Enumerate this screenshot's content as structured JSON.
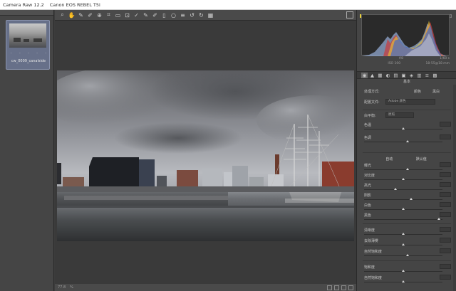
{
  "window": {
    "app_title": "Camera Raw 12.2",
    "camera": "Canon EOS REBEL T5i"
  },
  "filmstrip": {
    "header": "",
    "thumbnail": {
      "stars": [
        "·",
        "·",
        "·",
        "·",
        "·"
      ],
      "filename": "cw_0009_canalside"
    }
  },
  "toolbar": {
    "tools": [
      {
        "name": "zoom-icon",
        "glyph": "⌕"
      },
      {
        "name": "hand-icon",
        "glyph": "✋"
      },
      {
        "name": "white-balance-icon",
        "glyph": "✎"
      },
      {
        "name": "color-sampler-icon",
        "glyph": "✐"
      },
      {
        "name": "targeted-adjustment-icon",
        "glyph": "⊕"
      },
      {
        "name": "crop-icon",
        "glyph": "⌗"
      },
      {
        "name": "straighten-icon",
        "glyph": "▭"
      },
      {
        "name": "transform-icon",
        "glyph": "⊡"
      },
      {
        "name": "spot-removal-icon",
        "glyph": "✓"
      },
      {
        "name": "red-eye-icon",
        "glyph": "✎"
      },
      {
        "name": "adjustment-brush-icon",
        "glyph": "✐"
      },
      {
        "name": "graduated-filter-icon",
        "glyph": "▯"
      },
      {
        "name": "radial-filter-icon",
        "glyph": "○"
      },
      {
        "name": "preferences-icon",
        "glyph": "≡"
      },
      {
        "name": "rotate-left-icon",
        "glyph": "↺"
      },
      {
        "name": "rotate-right-icon",
        "glyph": "↻"
      },
      {
        "name": "trash-icon",
        "glyph": "▦"
      }
    ]
  },
  "status": {
    "left": [
      "77.8",
      "%"
    ],
    "center": "",
    "right_icons": [
      "before-after-icon",
      "swap-icon",
      "copy-icon",
      "settings-icon"
    ]
  },
  "panel": {
    "readout": {
      "row1": [
        "",
        "f/8",
        "1/60 s"
      ],
      "row2": [
        "",
        "ISO 100",
        "18-55@18 mm"
      ]
    },
    "tabs": [
      "basic-icon",
      "tone-curve-icon",
      "detail-icon",
      "hsl-icon",
      "split-toning-icon",
      "lens-icon",
      "effects-icon",
      "calibration-icon",
      "presets-icon",
      "snapshots-icon"
    ],
    "section_title": "基本",
    "treatment": {
      "label": "处理方式:",
      "color": "颜色",
      "bw": "黑白"
    },
    "profile": {
      "label": "配置文件:",
      "value": "Adobe 颜色"
    },
    "white_balance": {
      "label": "白平衡:",
      "value": "原照"
    },
    "sliders_top": [
      {
        "label": "色温",
        "pos": 0.5
      },
      {
        "label": "色调",
        "pos": 0.55
      }
    ],
    "auto_default": {
      "auto": "自动",
      "default": "默认值"
    },
    "sliders_mid": [
      {
        "label": "曝光",
        "pos": 0.55
      },
      {
        "label": "对比度",
        "pos": 0.5
      },
      {
        "label": "高光",
        "pos": 0.4
      },
      {
        "label": "阴影",
        "pos": 0.6
      },
      {
        "label": "白色",
        "pos": 0.5
      },
      {
        "label": "黑色",
        "pos": 0.95
      }
    ],
    "sliders_bottom": [
      {
        "label": "清晰度",
        "pos": 0.5
      },
      {
        "label": "去除薄雾",
        "pos": 0.5
      },
      {
        "label": "自然饱和度",
        "pos": 0.55
      }
    ],
    "sliders_last": [
      {
        "label": "饱和度",
        "pos": 0.5
      },
      {
        "label": "自然饱和度",
        "pos": 0.5
      }
    ]
  }
}
